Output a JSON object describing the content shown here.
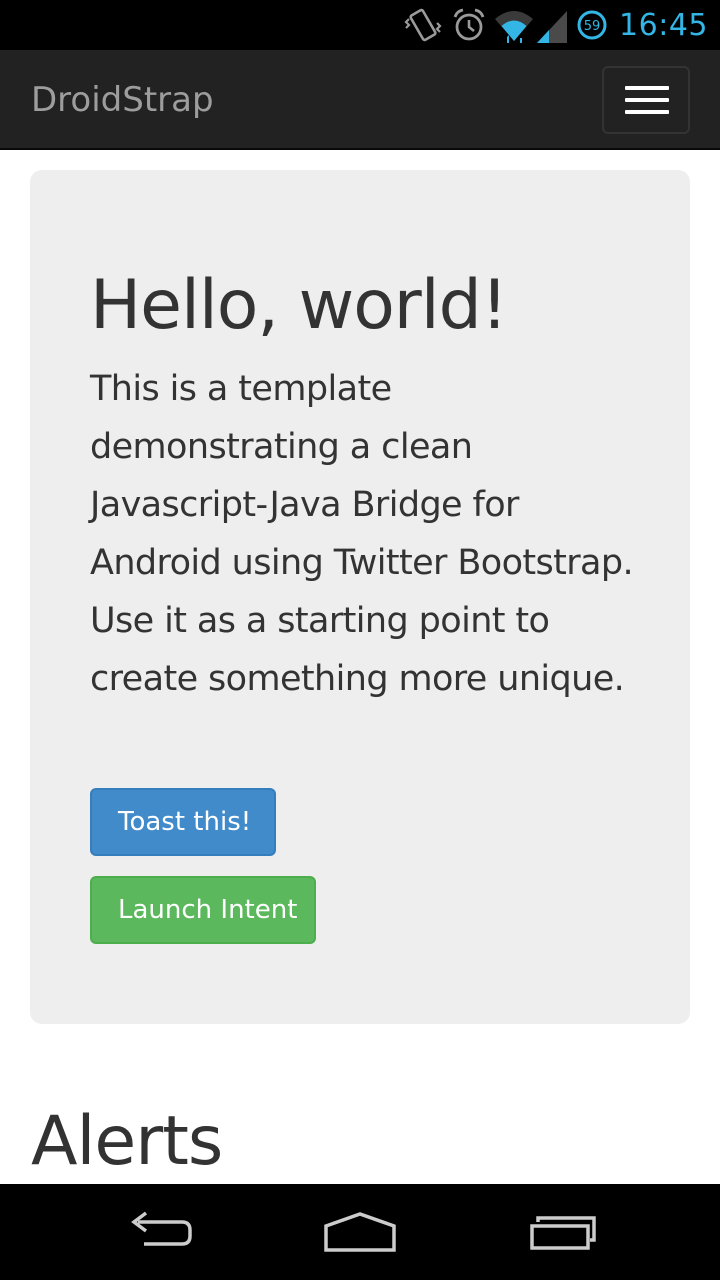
{
  "status_bar": {
    "time": "16:45",
    "battery_level": "59",
    "icons": [
      "vibrate-icon",
      "alarm-icon",
      "wifi-icon",
      "signal-icon",
      "battery-icon"
    ],
    "time_color": "#33b5e5"
  },
  "navbar": {
    "brand": "DroidStrap",
    "toggle_icon": "menu-icon",
    "background": "#222222"
  },
  "jumbotron": {
    "title": "Hello, world!",
    "text": "This is a template demonstrating a clean Javascript-Java Bridge for Android using Twitter Bootstrap. Use it as a starting point to create something more unique.",
    "buttons": [
      {
        "label": "Toast this!",
        "color": "#428bca"
      },
      {
        "label": "Launch Intent",
        "color": "#5cb85c"
      }
    ]
  },
  "sections": {
    "alerts_heading": "Alerts"
  },
  "system_nav": {
    "icons": [
      "back-icon",
      "home-icon",
      "recent-apps-icon"
    ]
  }
}
